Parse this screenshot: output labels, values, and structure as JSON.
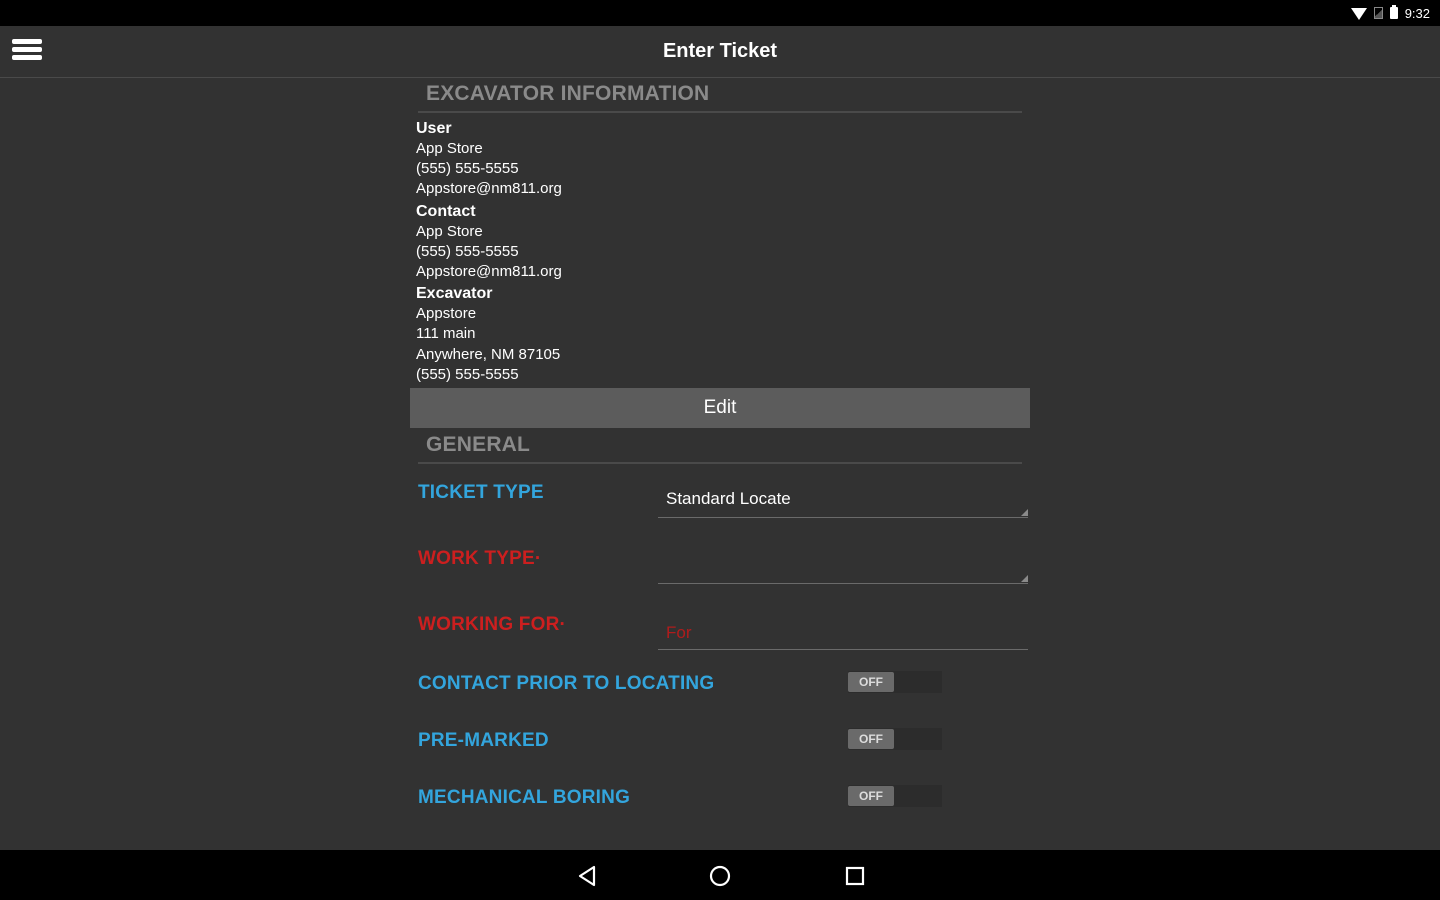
{
  "status_bar": {
    "time": "9:32"
  },
  "app_bar": {
    "title": "Enter Ticket"
  },
  "excavator_section": {
    "header": "EXCAVATOR INFORMATION",
    "groups": [
      {
        "heading": "User",
        "lines": [
          "App Store",
          "(555) 555-5555",
          "Appstore@nm811.org"
        ]
      },
      {
        "heading": "Contact",
        "lines": [
          "App Store",
          "(555) 555-5555",
          "Appstore@nm811.org"
        ]
      },
      {
        "heading": "Excavator",
        "lines": [
          "Appstore",
          "111 main",
          "Anywhere, NM 87105",
          "(555) 555-5555"
        ]
      }
    ],
    "edit_label": "Edit"
  },
  "general_section": {
    "header": "GENERAL",
    "ticket_type": {
      "label": "TICKET TYPE",
      "value": "Standard Locate"
    },
    "work_type": {
      "label": "WORK TYPE·",
      "value": ""
    },
    "working_for": {
      "label": "WORKING FOR·",
      "placeholder": "For"
    },
    "toggles": [
      {
        "label": "CONTACT PRIOR TO LOCATING",
        "state": "OFF"
      },
      {
        "label": "PRE-MARKED",
        "state": "OFF"
      },
      {
        "label": "MECHANICAL BORING",
        "state": "OFF"
      }
    ]
  },
  "colors": {
    "background": "#323232",
    "label_blue": "#33a5dd",
    "label_required_red": "#cc1f1f",
    "section_header_gray": "#8a8a8a",
    "edit_button": "#5c5c5c"
  }
}
